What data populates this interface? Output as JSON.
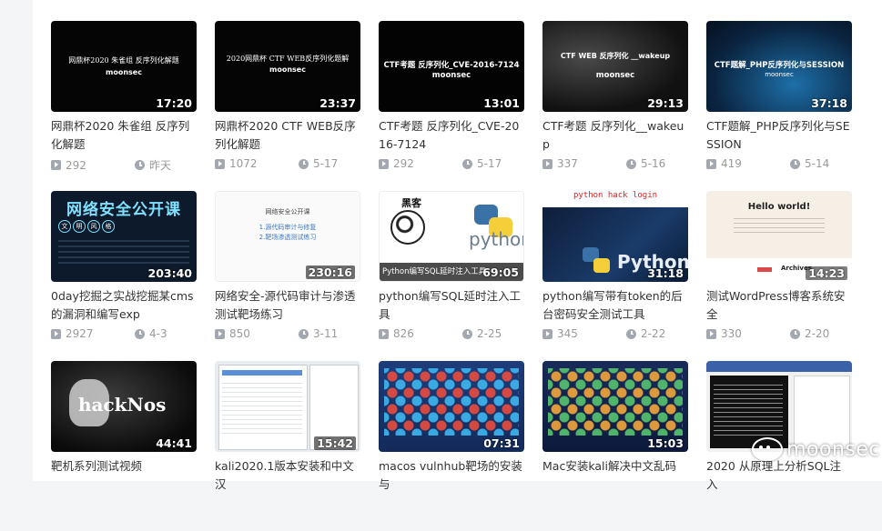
{
  "videos": [
    {
      "title": "网鼎杯2020 朱雀组 反序列化解题",
      "duration": "17:20",
      "views": "292",
      "date": "昨天",
      "thumb_lines": [
        "网鼎杯2020 朱雀组 反序列化解题",
        "moonsec"
      ]
    },
    {
      "title": "网鼎杯2020 CTF WEB反序列化解题",
      "duration": "23:37",
      "views": "1072",
      "date": "5-17",
      "thumb_lines": [
        "2020网鼎杯 CTF WEB反序列化题解",
        "moonsec"
      ]
    },
    {
      "title": "CTF考题 反序列化_CVE-2016-7124",
      "duration": "13:01",
      "views": "292",
      "date": "5-17",
      "thumb_lines": [
        "CTF考题 反序列化_CVE-2016-7124",
        "moonsec"
      ]
    },
    {
      "title": "CTF考题 反序列化__wakeup",
      "duration": "29:13",
      "views": "337",
      "date": "5-16",
      "thumb_lines": [
        "CTF WEB 反序列化 __wakeup",
        "moonsec"
      ]
    },
    {
      "title": "CTF题解_PHP反序列化与SESSION",
      "duration": "37:18",
      "views": "419",
      "date": "5-14",
      "thumb_lines": [
        "CTF题解_PHP反序列化与SESSION",
        "moonsec"
      ]
    },
    {
      "title": "0day挖掘之实战挖掘某cms的漏洞和编写exp",
      "duration": "203:40",
      "views": "2927",
      "date": "4-3",
      "thumb_lines": [
        "网络安全公开课",
        "文",
        "明",
        "风",
        "格"
      ]
    },
    {
      "title": "网络安全-源代码审计与渗透测试靶场练习",
      "duration": "230:16",
      "views": "850",
      "date": "3-11",
      "thumb_lines": [
        "网络安全公开课",
        "1.源代码审计与修复",
        "2.靶场渗透测试练习"
      ]
    },
    {
      "title": "python编写SQL延时注入工具",
      "duration": "69:05",
      "views": "826",
      "date": "2-25",
      "thumb_lines": [
        "黑客",
        "python",
        "Python编写SQL延时注入工具"
      ]
    },
    {
      "title": "python编写带有token的后台密码安全测试工具",
      "duration": "31:18",
      "views": "345",
      "date": "2-22",
      "thumb_lines": [
        "python hack login",
        "Python"
      ]
    },
    {
      "title": "测试WordPress博客系统安全",
      "duration": "14:23",
      "views": "330",
      "date": "2-20",
      "thumb_lines": [
        "Hello world!",
        "Archives"
      ]
    },
    {
      "title": "靶机系列测试视频",
      "duration": "44:41",
      "views": "",
      "date": "",
      "thumb_lines": [
        "hackNos"
      ]
    },
    {
      "title": "kali2020.1版本安装和中文汉",
      "duration": "15:42",
      "views": "",
      "date": "",
      "thumb_lines": []
    },
    {
      "title": "macos vulnhub靶场的安装与",
      "duration": "07:31",
      "views": "",
      "date": "",
      "thumb_lines": []
    },
    {
      "title": "Mac安装kali解决中文乱码",
      "duration": "15:03",
      "views": "",
      "date": "",
      "thumb_lines": []
    },
    {
      "title": "2020 从原理上分析SQL注入",
      "duration": "",
      "views": "",
      "date": "",
      "thumb_lines": []
    }
  ],
  "watermark": "moonsec",
  "colors": {
    "meta_text": "#9a9a9a",
    "title_text": "#333333",
    "icon_gray": "#a3a8b0"
  }
}
